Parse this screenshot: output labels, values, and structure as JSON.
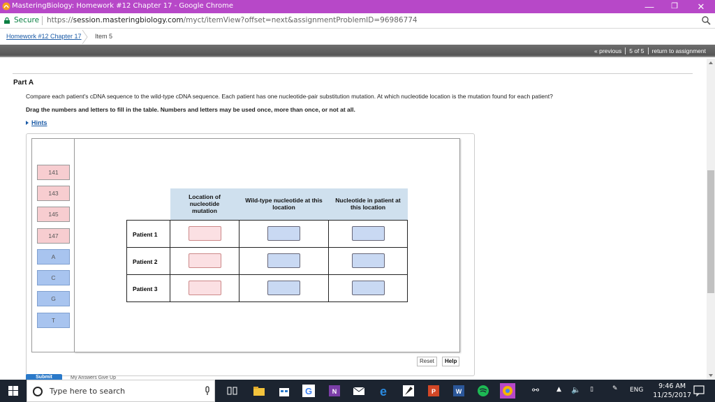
{
  "window": {
    "title": "MasteringBiology: Homework #12 Chapter 17 - Google Chrome",
    "minimize": "—",
    "restore": "❐",
    "close": "✕"
  },
  "address": {
    "secure_label": "Secure",
    "url_prefix": "https://",
    "url_host": "session.masteringbiology.com",
    "url_path": "/myct/itemView?offset=next&assignmentProblemID=96986774"
  },
  "breadcrumb": {
    "assignment": "Homework #12 Chapter 17",
    "item": "Item 5"
  },
  "nav": {
    "previous": "« previous",
    "position": "5 of 5",
    "return": "return to assignment"
  },
  "question": {
    "part": "Part A",
    "instruction": "Compare each patient's cDNA sequence to the wild-type cDNA sequence. Each patient has one nucleotide-pair substitution mutation. At which nucleotide location is the mutation found for each patient?",
    "drag_instruction": "Drag the numbers and letters to fill in the table. Numbers and letters may be used once, more than once, or not at all.",
    "hints": "Hints"
  },
  "palette": {
    "numbers": [
      "141",
      "143",
      "145",
      "147"
    ],
    "letters": [
      "A",
      "C",
      "G",
      "T"
    ]
  },
  "table": {
    "headers": [
      "Location of nucleotide mutation",
      "Wild-type nucleotide at this location",
      "Nucleotide in patient at this location"
    ],
    "rows": [
      "Patient 1",
      "Patient 2",
      "Patient 3"
    ]
  },
  "buttons": {
    "reset": "Reset",
    "help": "Help",
    "submit": "Submit",
    "my_answers": "My Answers   Give Up"
  },
  "taskbar": {
    "search_placeholder": "Type here to search",
    "language": "ENG",
    "time": "9:46 AM",
    "date": "11/25/2017"
  },
  "colors": {
    "chrome_titlebar": "#b748c8",
    "number_tile": "#f7cdd0",
    "letter_tile": "#a8c4ef",
    "table_header": "#cfe0ee",
    "link": "#1a5aa6",
    "taskbar": "#1c2430"
  }
}
